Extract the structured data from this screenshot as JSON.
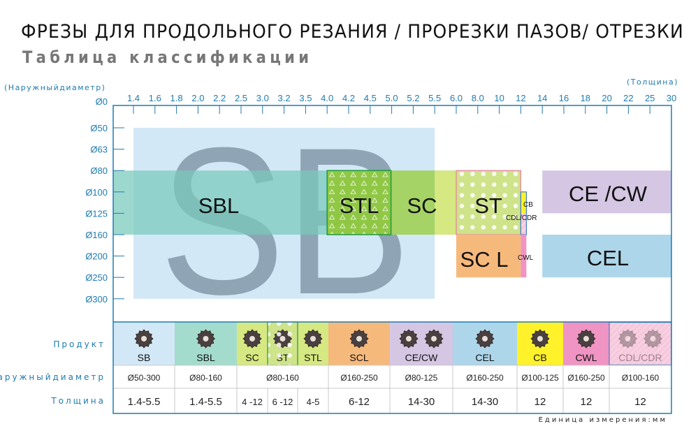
{
  "header": {
    "title": "ФРЕЗЫ ДЛЯ ПРОДОЛЬНОГО РЕЗАНИЯ / ПРОРЕЗКИ ПАЗОВ/ ОТРЕЗКИ",
    "subtitle": "Таблица классификации"
  },
  "chart_data": {
    "type": "table",
    "title": "Таблица классификации",
    "ylabel": "(Наружныйдиаметр)",
    "xlabel": "(Толщина)",
    "x_ticks": [
      "1.4",
      "1.6",
      "1.8",
      "2.0",
      "2.2",
      "2.5",
      "3.0",
      "3.2",
      "3.5",
      "4.0",
      "4.2",
      "4.5",
      "5.0",
      "5.2",
      "5.5",
      "6.0",
      "8.0",
      "10",
      "12",
      "14",
      "16",
      "18",
      "20",
      "22",
      "25",
      "30"
    ],
    "y_ticks": [
      "Ø0",
      "Ø50",
      "Ø63",
      "Ø80",
      "Ø100",
      "Ø125",
      "Ø160",
      "Ø200",
      "Ø250",
      "Ø300"
    ],
    "watermark": "SB",
    "regions": [
      {
        "name": "SB",
        "label": "",
        "x_from": "1.4",
        "x_to": "5.5",
        "y_from": "Ø50",
        "y_to": "Ø300",
        "color": "#d3e8f6"
      },
      {
        "name": "SBL",
        "label": "SBL",
        "x_from": "start",
        "x_to": "6.0",
        "y_from": "Ø80",
        "y_to": "Ø160",
        "color": "#77c9bb"
      },
      {
        "name": "SC",
        "label": "SC",
        "x_from": "4.0",
        "x_to": "6.0",
        "y_from": "Ø80",
        "y_to": "Ø160",
        "color": "#a9d35a"
      },
      {
        "name": "STL",
        "label": "STL",
        "x_from": "4.0",
        "x_to": "5.0",
        "y_from": "Ø80",
        "y_to": "Ø160",
        "color": "#8cc63f"
      },
      {
        "name": "ST",
        "label": "ST",
        "x_from": "6.0",
        "x_to": "12",
        "y_from": "Ø80",
        "y_to": "Ø160",
        "color": "#cfe38a"
      },
      {
        "name": "SCL",
        "label": "SC L",
        "x_from": "6.0",
        "x_to": "12",
        "y_from": "Ø160",
        "y_to": "Ø250",
        "color": "#f6b97c"
      },
      {
        "name": "CB",
        "label": "CB",
        "x": "12",
        "y_from": "Ø100",
        "y_to": "Ø125",
        "color": "#fff22a"
      },
      {
        "name": "CDL/CDR",
        "label": "CDL/CDR",
        "x": "12",
        "y_from": "Ø125",
        "y_to": "Ø160",
        "color": "#f6c8dc"
      },
      {
        "name": "CWL",
        "label": "CWL",
        "x": "12",
        "y_from": "Ø160",
        "y_to": "Ø250",
        "color": "#ef94c3"
      },
      {
        "name": "CE/CW",
        "label": "CE /CW",
        "x_from": "14",
        "x_to": "30",
        "y_from": "Ø80",
        "y_to": "Ø125",
        "color": "#d5c6e3"
      },
      {
        "name": "CEL",
        "label": "CEL",
        "x_from": "14",
        "x_to": "30",
        "y_from": "Ø160",
        "y_to": "Ø250",
        "color": "#aed6ea"
      }
    ],
    "table": {
      "row_labels": {
        "product": "Продукт",
        "diameter": "Наружныйдиаметр",
        "thickness": "Толщина"
      },
      "products": [
        {
          "name": "SB",
          "color": "#d3e8f6"
        },
        {
          "name": "SBL",
          "color": "#a3dccd"
        },
        {
          "name": "SC",
          "color": "#d6e881"
        },
        {
          "name": "ST",
          "color": "#cfe38a"
        },
        {
          "name": "STL",
          "color": "#d6e881"
        },
        {
          "name": "SCL",
          "color": "#f6b97c"
        },
        {
          "name": "CE/CW",
          "color": "#d5c6e3"
        },
        {
          "name": "CEL",
          "color": "#aed6ea"
        },
        {
          "name": "CB",
          "color": "#fff22a"
        },
        {
          "name": "CWL",
          "color": "#ef94c3"
        },
        {
          "name": "CDL/CDR",
          "color": "#f6c8dc"
        }
      ],
      "diameter": [
        {
          "span": [
            "SB"
          ],
          "value": "Ø50-300"
        },
        {
          "span": [
            "SBL"
          ],
          "value": "Ø80-160"
        },
        {
          "span": [
            "SC",
            "ST",
            "STL"
          ],
          "value": "Ø80-160"
        },
        {
          "span": [
            "SCL"
          ],
          "value": "Ø160-250"
        },
        {
          "span": [
            "CE/CW"
          ],
          "value": "Ø80-125"
        },
        {
          "span": [
            "CEL"
          ],
          "value": "Ø160-250"
        },
        {
          "span": [
            "CB"
          ],
          "value": "Ø100-125"
        },
        {
          "span": [
            "CWL"
          ],
          "value": "Ø160-250"
        },
        {
          "span": [
            "CDL/CDR"
          ],
          "value": "Ø100-160"
        }
      ],
      "thickness": [
        "1.4-5.5",
        "1.4-5.5",
        "4 -12",
        "6 -12",
        "4-5",
        "6-12",
        "14-30",
        "14-30",
        "12",
        "12",
        "12"
      ]
    },
    "unit_note": "Единица измерения:мм"
  },
  "colors": {
    "axis": "#1f7bb0",
    "watermark": "#8fa5b5"
  }
}
